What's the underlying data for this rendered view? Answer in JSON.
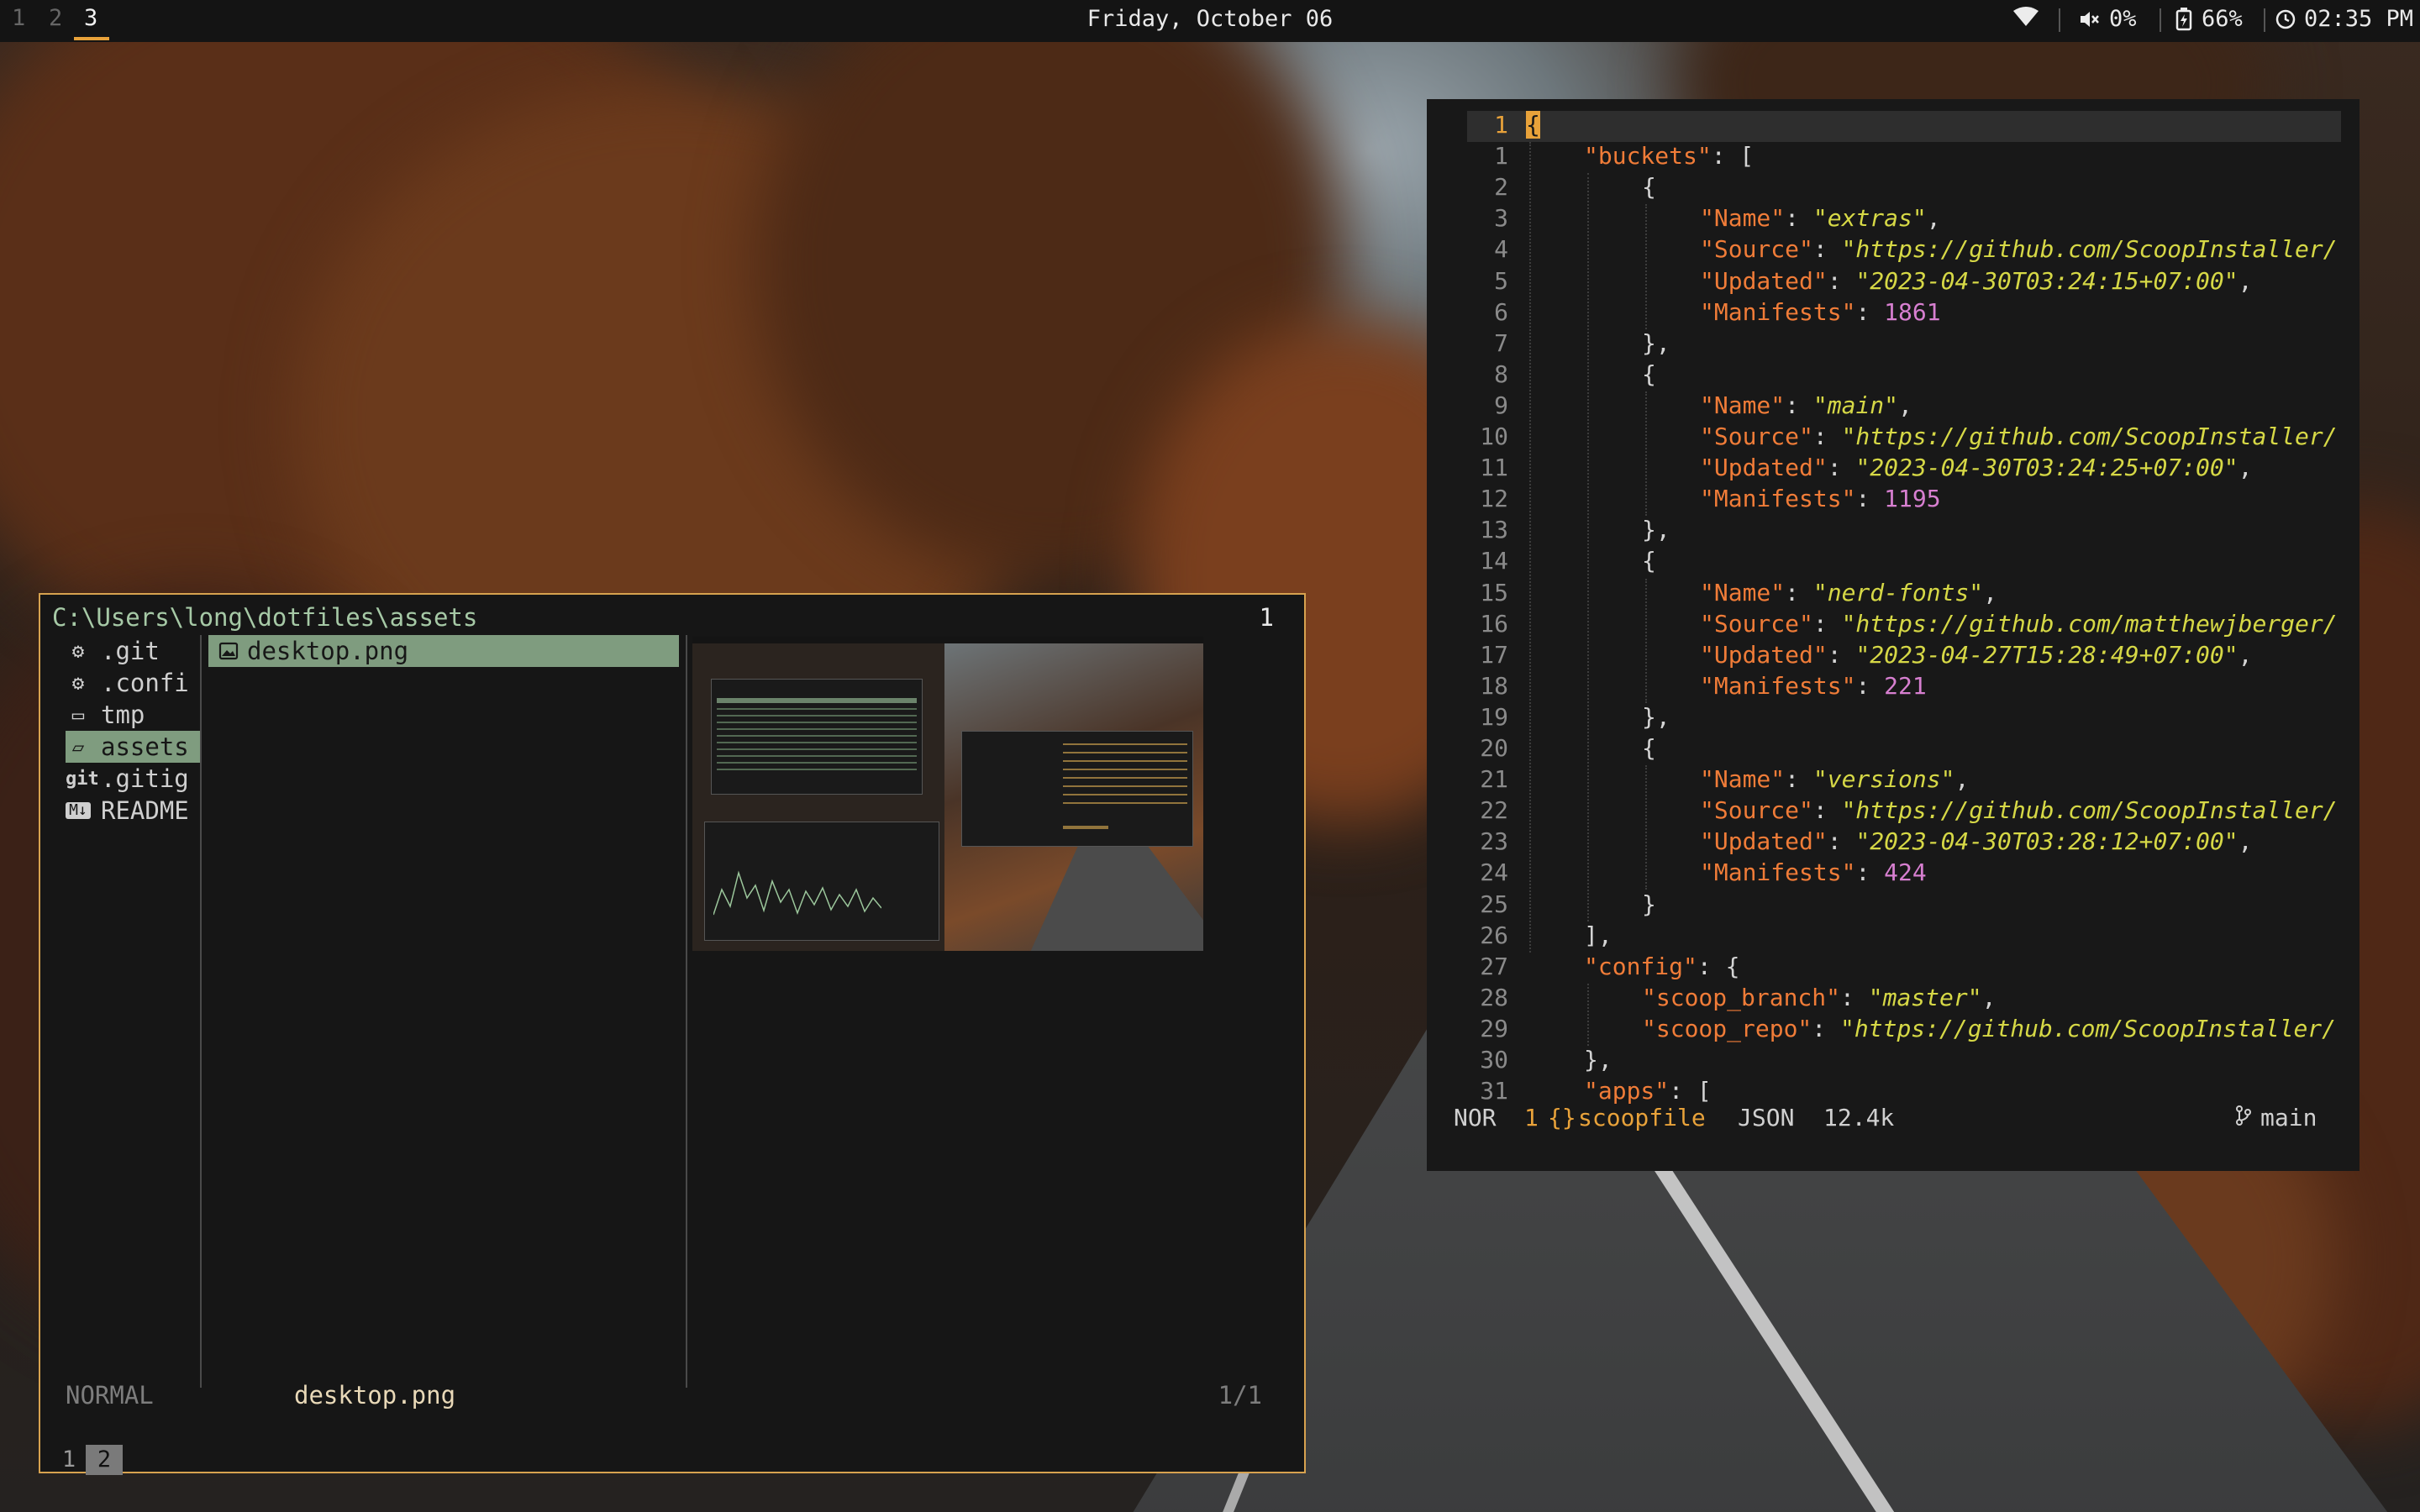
{
  "topbar": {
    "workspaces": [
      "1",
      "2",
      "3"
    ],
    "active_workspace": "3",
    "date": "Friday, October 06",
    "volume": "0%",
    "battery": "66%",
    "time": "02:35 PM",
    "accent_color": "#e8a23a"
  },
  "file_manager": {
    "path": "C:\\Users\\long\\dotfiles\\assets",
    "count": "1",
    "parent_items": [
      {
        "icon": "git-folder-icon",
        "label": ".git"
      },
      {
        "icon": "config-folder-icon",
        "label": ".confi"
      },
      {
        "icon": "folder-icon",
        "label": "tmp"
      },
      {
        "icon": "folder-open-icon",
        "label": "assets"
      },
      {
        "icon": "git-file-icon",
        "label": ".gitig"
      },
      {
        "icon": "markdown-icon",
        "label": "README"
      }
    ],
    "selected_parent": "assets",
    "current_items": [
      {
        "icon": "image-file-icon",
        "label": "desktop.png"
      }
    ],
    "status": {
      "mode": "NORMAL",
      "file": "desktop.png",
      "position": "1/1"
    },
    "tabs": [
      "1",
      "2"
    ],
    "active_tab": "2",
    "border_color": "#d7a24f",
    "selection_color": "#7f9c7f"
  },
  "editor": {
    "cursor_line": "1",
    "lines": [
      [
        [
          "p",
          "{"
        ]
      ],
      [
        [
          "k",
          "\"buckets\""
        ],
        [
          "p",
          ": ["
        ]
      ],
      [
        [
          "p",
          "{"
        ]
      ],
      [
        [
          "k",
          "\"Name\""
        ],
        [
          "p",
          ": "
        ],
        [
          "s",
          "\"extras\""
        ],
        [
          "p",
          ","
        ]
      ],
      [
        [
          "k",
          "\"Source\""
        ],
        [
          "p",
          ": "
        ],
        [
          "s",
          "\"https://github.com/ScoopInstaller/"
        ]
      ],
      [
        [
          "k",
          "\"Updated\""
        ],
        [
          "p",
          ": "
        ],
        [
          "s",
          "\"2023-04-30T03:24:15+07:00\""
        ],
        [
          "p",
          ","
        ]
      ],
      [
        [
          "k",
          "\"Manifests\""
        ],
        [
          "p",
          ": "
        ],
        [
          "n",
          "1861"
        ]
      ],
      [
        [
          "p",
          "},"
        ]
      ],
      [
        [
          "p",
          "{"
        ]
      ],
      [
        [
          "k",
          "\"Name\""
        ],
        [
          "p",
          ": "
        ],
        [
          "s",
          "\"main\""
        ],
        [
          "p",
          ","
        ]
      ],
      [
        [
          "k",
          "\"Source\""
        ],
        [
          "p",
          ": "
        ],
        [
          "s",
          "\"https://github.com/ScoopInstaller/"
        ]
      ],
      [
        [
          "k",
          "\"Updated\""
        ],
        [
          "p",
          ": "
        ],
        [
          "s",
          "\"2023-04-30T03:24:25+07:00\""
        ],
        [
          "p",
          ","
        ]
      ],
      [
        [
          "k",
          "\"Manifests\""
        ],
        [
          "p",
          ": "
        ],
        [
          "n",
          "1195"
        ]
      ],
      [
        [
          "p",
          "},"
        ]
      ],
      [
        [
          "p",
          "{"
        ]
      ],
      [
        [
          "k",
          "\"Name\""
        ],
        [
          "p",
          ": "
        ],
        [
          "s",
          "\"nerd-fonts\""
        ],
        [
          "p",
          ","
        ]
      ],
      [
        [
          "k",
          "\"Source\""
        ],
        [
          "p",
          ": "
        ],
        [
          "s",
          "\"https://github.com/matthewjberger/"
        ]
      ],
      [
        [
          "k",
          "\"Updated\""
        ],
        [
          "p",
          ": "
        ],
        [
          "s",
          "\"2023-04-27T15:28:49+07:00\""
        ],
        [
          "p",
          ","
        ]
      ],
      [
        [
          "k",
          "\"Manifests\""
        ],
        [
          "p",
          ": "
        ],
        [
          "n",
          "221"
        ]
      ],
      [
        [
          "p",
          "},"
        ]
      ],
      [
        [
          "p",
          "{"
        ]
      ],
      [
        [
          "k",
          "\"Name\""
        ],
        [
          "p",
          ": "
        ],
        [
          "s",
          "\"versions\""
        ],
        [
          "p",
          ","
        ]
      ],
      [
        [
          "k",
          "\"Source\""
        ],
        [
          "p",
          ": "
        ],
        [
          "s",
          "\"https://github.com/ScoopInstaller/"
        ]
      ],
      [
        [
          "k",
          "\"Updated\""
        ],
        [
          "p",
          ": "
        ],
        [
          "s",
          "\"2023-04-30T03:28:12+07:00\""
        ],
        [
          "p",
          ","
        ]
      ],
      [
        [
          "k",
          "\"Manifests\""
        ],
        [
          "p",
          ": "
        ],
        [
          "n",
          "424"
        ]
      ],
      [
        [
          "p",
          "}"
        ]
      ],
      [
        [
          "p",
          "],"
        ]
      ],
      [
        [
          "k",
          "\"config\""
        ],
        [
          "p",
          ": {"
        ]
      ],
      [
        [
          "k",
          "\"scoop_branch\""
        ],
        [
          "p",
          ": "
        ],
        [
          "s",
          "\"master\""
        ],
        [
          "p",
          ","
        ]
      ],
      [
        [
          "k",
          "\"scoop_repo\""
        ],
        [
          "p",
          ": "
        ],
        [
          "s",
          "\"https://github.com/ScoopInstaller/"
        ]
      ],
      [
        [
          "p",
          "},"
        ]
      ],
      [
        [
          "k",
          "\"apps\""
        ],
        [
          "p",
          ": ["
        ]
      ]
    ],
    "status": {
      "mode": "NOR",
      "buffer_number": "1",
      "file_icon": "{}",
      "filename": "scoopfile",
      "filetype": "JSON",
      "size": "12.4k",
      "branch": "main"
    },
    "colors": {
      "key": "#f07c38",
      "string": "#d6d846",
      "number": "#d77fd0"
    }
  }
}
